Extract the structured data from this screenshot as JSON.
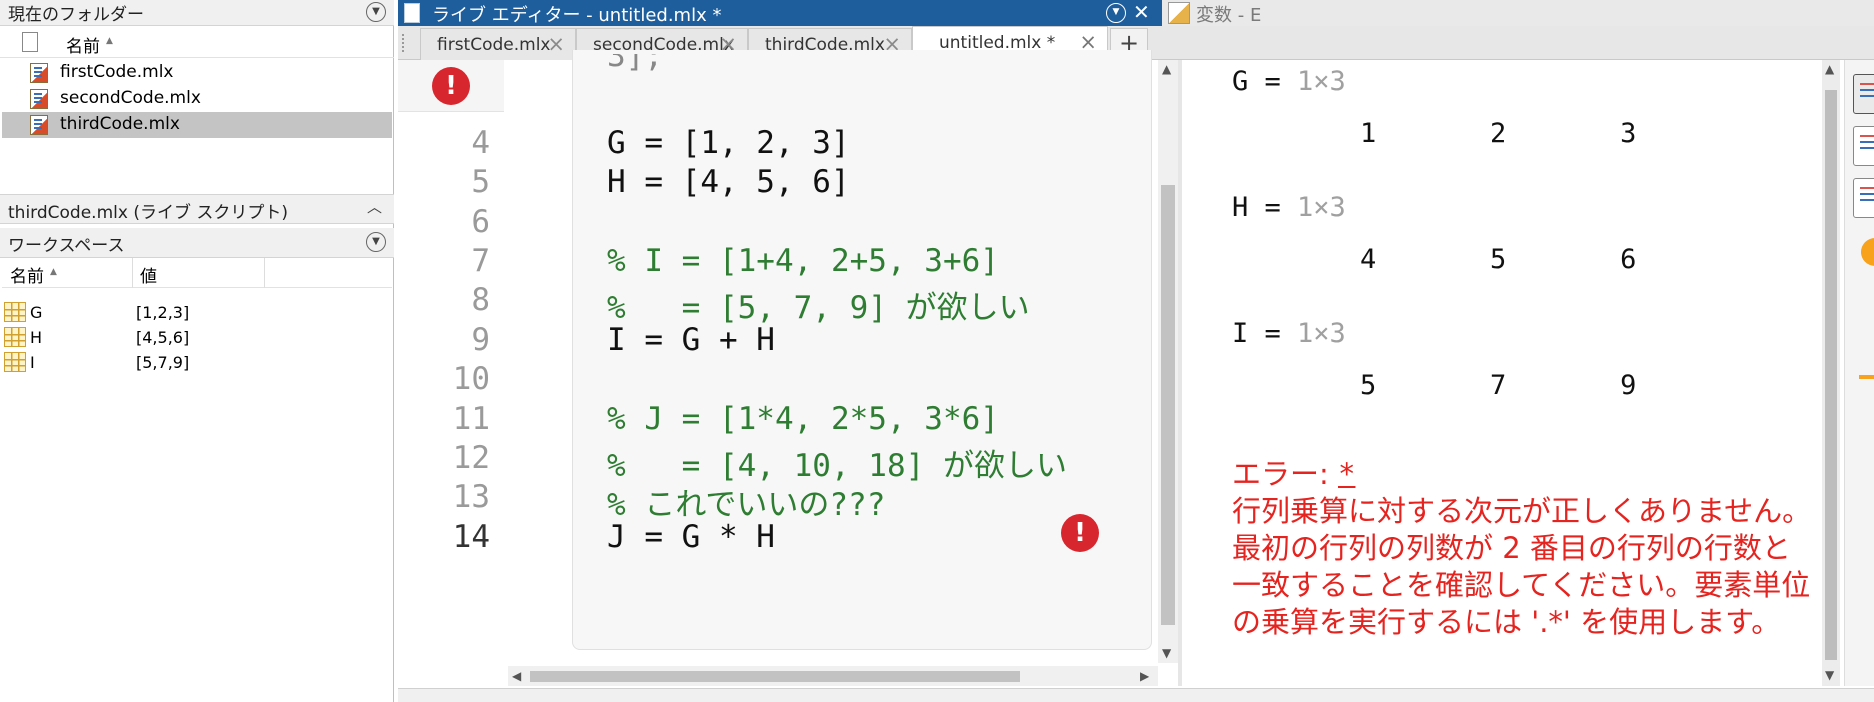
{
  "left_panel": {
    "current_folder": {
      "title": "現在のフォルダー",
      "column_name": "名前"
    },
    "files": [
      {
        "name": "firstCode.mlx"
      },
      {
        "name": "secondCode.mlx"
      },
      {
        "name": "thirdCode.mlx"
      }
    ],
    "details_title": "thirdCode.mlx  (ライブ スクリプト)",
    "workspace": {
      "title": "ワークスペース",
      "columns": {
        "name": "名前",
        "value": "値"
      },
      "variables": [
        {
          "name": "G",
          "value": "[1,2,3]"
        },
        {
          "name": "H",
          "value": "[4,5,6]"
        },
        {
          "name": "I",
          "value": "[5,7,9]"
        }
      ]
    }
  },
  "editor": {
    "window_title": "ライブ エディター - untitled.mlx *",
    "variables_window_title": "変数 - E",
    "tabs": [
      {
        "label": "firstCode.mlx"
      },
      {
        "label": "secondCode.mlx"
      },
      {
        "label": "thirdCode.mlx"
      },
      {
        "label": "untitled.mlx *"
      }
    ],
    "add_tab_label": "+",
    "top_partial_code": "3];",
    "code_lines": [
      {
        "num": "4",
        "text": "G = [1, 2, 3]"
      },
      {
        "num": "5",
        "text": "H = [4, 5, 6]"
      },
      {
        "num": "6",
        "text": ""
      },
      {
        "num": "7",
        "text": "% I = [1+4, 2+5, 3+6]"
      },
      {
        "num": "8",
        "text": "%   = [5, 7, 9] が欲しい"
      },
      {
        "num": "9",
        "text": "I = G + H"
      },
      {
        "num": "10",
        "text": ""
      },
      {
        "num": "11",
        "text": "% J = [1*4, 2*5, 3*6]"
      },
      {
        "num": "12",
        "text": "%   = [4, 10, 18] が欲しい"
      },
      {
        "num": "13",
        "text": "% これでいいの???"
      },
      {
        "num": "14",
        "text": "J = G * H"
      }
    ]
  },
  "output": {
    "results": [
      {
        "name": "G = ",
        "size": "1×3",
        "values": "1       2       3"
      },
      {
        "name": "H = ",
        "size": "1×3",
        "values": "4       5       6"
      },
      {
        "name": "I = ",
        "size": "1×3",
        "values": "5       7       9"
      }
    ],
    "error": {
      "label": "エラー: ",
      "operator": " * ",
      "message": "行列乗算に対する次元が正しくありません。最初の行列の列数が 2 番目の行列の行数と一致することを確認してください。要素単位の乗算を実行するには '.*' を使用します。"
    }
  },
  "colors": {
    "titlebar": "#1e5e9c",
    "error_red": "#e5231f",
    "comment_green": "#2e7d32",
    "error_icon": "#d8262e",
    "warning_orange": "#f7a21a"
  },
  "icons": {
    "current_folder_menu": "dropdown-circle-icon",
    "details_collapse": "chevron-up-icon",
    "workspace_menu": "dropdown-circle-icon",
    "file": "live-script-file-icon",
    "variable": "matrix-variable-icon",
    "error": "error-circle-icon",
    "tab_close": "close-icon"
  }
}
